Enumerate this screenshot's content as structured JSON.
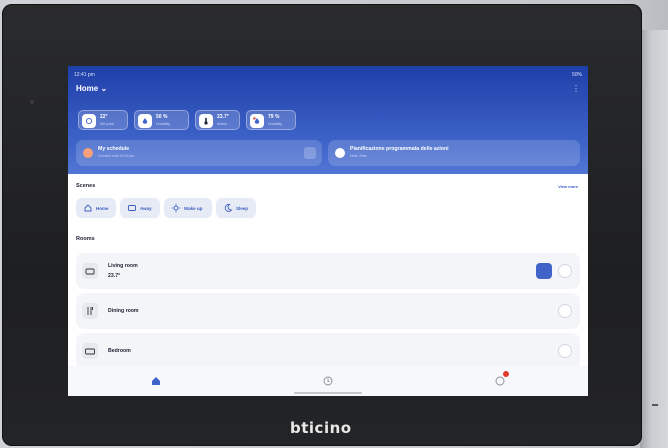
{
  "status_bar": {
    "time": "12:41 pm",
    "right": "50%"
  },
  "header": {
    "title": "Home"
  },
  "sensors": [
    {
      "value": "22°",
      "label": "Set point"
    },
    {
      "value": "50 %",
      "label": "Humidity"
    },
    {
      "value": "23.7°",
      "label": "Indoor"
    },
    {
      "value": "79 %",
      "label": "Humidity"
    }
  ],
  "cards": [
    {
      "title": "My schedule",
      "subtitle": "Comfort until 10:00 pm"
    },
    {
      "title": "Pianificazione programmata delle azioni",
      "subtitle": "Next: After"
    }
  ],
  "scenes": {
    "title": "Scenes",
    "view_more": "View more",
    "items": [
      {
        "label": "Home"
      },
      {
        "label": "Away"
      },
      {
        "label": "Wake up"
      },
      {
        "label": "Sleep"
      }
    ]
  },
  "rooms": {
    "title": "Rooms",
    "items": [
      {
        "name": "Living room",
        "temp": "23.7°"
      },
      {
        "name": "Dining room"
      },
      {
        "name": "Bedroom"
      }
    ]
  },
  "brand": {
    "logo_text": "bticino"
  },
  "colors": {
    "accent": "#3f63c9",
    "header_top": "#1f3fa8",
    "badge": "#e33b2e"
  }
}
